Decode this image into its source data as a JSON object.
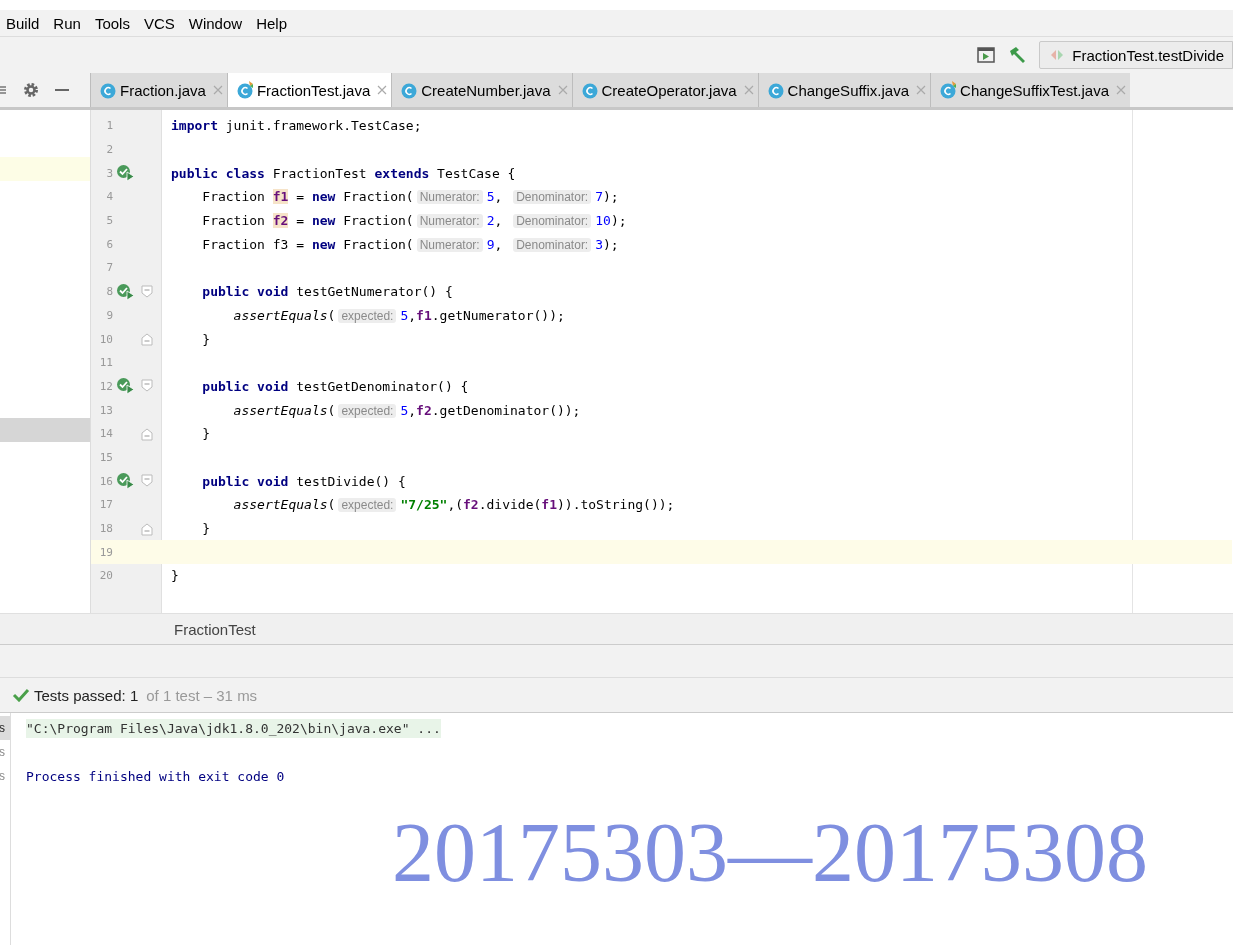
{
  "menu": [
    "Build",
    "Run",
    "Tools",
    "VCS",
    "Window",
    "Help"
  ],
  "run_config": {
    "label": "FractionTest.testDivide"
  },
  "tabs": [
    {
      "label": "Fraction.java",
      "kind": "class",
      "selected": false
    },
    {
      "label": "FractionTest.java",
      "kind": "test",
      "selected": true
    },
    {
      "label": "CreateNumber.java",
      "kind": "class",
      "selected": false
    },
    {
      "label": "CreateOperator.java",
      "kind": "class",
      "selected": false
    },
    {
      "label": "ChangeSuffix.java",
      "kind": "class",
      "selected": false
    },
    {
      "label": "ChangeSuffixTest.java",
      "kind": "test",
      "selected": false
    }
  ],
  "side_rows": [
    {
      "kind": "plain"
    },
    {
      "kind": "plain"
    },
    {
      "kind": "caret"
    },
    {
      "kind": "plain"
    },
    {
      "kind": "plain"
    },
    {
      "kind": "plain"
    },
    {
      "kind": "plain"
    },
    {
      "kind": "plain"
    },
    {
      "kind": "plain"
    },
    {
      "kind": "plain"
    },
    {
      "kind": "plain"
    },
    {
      "kind": "plain"
    },
    {
      "kind": "plain"
    },
    {
      "kind": "selected"
    },
    {
      "kind": "plain"
    },
    {
      "kind": "plain"
    },
    {
      "kind": "plain"
    },
    {
      "kind": "plain"
    },
    {
      "kind": "plain"
    },
    {
      "kind": "plain"
    }
  ],
  "lines": [
    {
      "number": "1",
      "run": false,
      "current": false,
      "tokens": [
        {
          "kind": "kw",
          "text": "import"
        },
        {
          "kind": "text",
          "text": " junit.framework.TestCase;"
        }
      ]
    },
    {
      "number": "2",
      "run": false,
      "current": false
    },
    {
      "number": "3",
      "run": true,
      "current": false,
      "tokens": [
        {
          "kind": "kw",
          "text": "public class"
        },
        {
          "kind": "text",
          "text": " FractionTest "
        },
        {
          "kind": "kw",
          "text": "extends"
        },
        {
          "kind": "text",
          "text": " TestCase {"
        }
      ]
    },
    {
      "number": "4",
      "run": false,
      "current": false,
      "tokens": [
        {
          "kind": "text",
          "text": "    Fraction "
        },
        {
          "kind": "usage",
          "text": "f1"
        },
        {
          "kind": "text",
          "text": " = "
        },
        {
          "kind": "kw",
          "text": "new"
        },
        {
          "kind": "text",
          "text": " Fraction("
        },
        {
          "kind": "hint",
          "text": "Numerator:"
        },
        {
          "kind": "num",
          "text": "5"
        },
        {
          "kind": "text",
          "text": ", "
        },
        {
          "kind": "hint",
          "text": "Denominator:"
        },
        {
          "kind": "num",
          "text": "7"
        },
        {
          "kind": "text",
          "text": ");"
        }
      ]
    },
    {
      "number": "5",
      "run": false,
      "current": false,
      "tokens": [
        {
          "kind": "text",
          "text": "    Fraction "
        },
        {
          "kind": "usage",
          "text": "f2"
        },
        {
          "kind": "text",
          "text": " = "
        },
        {
          "kind": "kw",
          "text": "new"
        },
        {
          "kind": "text",
          "text": " Fraction("
        },
        {
          "kind": "hint",
          "text": "Numerator:"
        },
        {
          "kind": "num",
          "text": "2"
        },
        {
          "kind": "text",
          "text": ", "
        },
        {
          "kind": "hint",
          "text": "Denominator:"
        },
        {
          "kind": "num",
          "text": "10"
        },
        {
          "kind": "text",
          "text": ");"
        }
      ]
    },
    {
      "number": "6",
      "run": false,
      "current": false,
      "tokens": [
        {
          "kind": "text",
          "text": "    Fraction f3 = "
        },
        {
          "kind": "kw",
          "text": "new"
        },
        {
          "kind": "text",
          "text": " Fraction("
        },
        {
          "kind": "hint",
          "text": "Numerator:"
        },
        {
          "kind": "num",
          "text": "9"
        },
        {
          "kind": "text",
          "text": ", "
        },
        {
          "kind": "hint",
          "text": "Denominator:"
        },
        {
          "kind": "num",
          "text": "3"
        },
        {
          "kind": "text",
          "text": ");"
        }
      ]
    },
    {
      "number": "7",
      "run": false,
      "current": false
    },
    {
      "number": "8",
      "run": true,
      "kind": "block_start",
      "current": false,
      "tokens": [
        {
          "kind": "kw",
          "text": "    public void"
        },
        {
          "kind": "text",
          "text": " testGetNumerator() {"
        }
      ]
    },
    {
      "number": "9",
      "run": false,
      "current": false,
      "tokens": [
        {
          "kind": "call",
          "text": "        assertEquals"
        },
        {
          "kind": "text",
          "text": "("
        },
        {
          "kind": "hint",
          "text": "expected:"
        },
        {
          "kind": "num",
          "text": "5"
        },
        {
          "kind": "text",
          "text": ","
        },
        {
          "kind": "field",
          "text": "f1"
        },
        {
          "kind": "text",
          "text": ".getNumerator());"
        }
      ]
    },
    {
      "number": "10",
      "run": false,
      "kind": "block_end",
      "current": false,
      "tokens": [
        {
          "kind": "text",
          "text": "    }"
        }
      ]
    },
    {
      "number": "11",
      "run": false,
      "current": false
    },
    {
      "number": "12",
      "run": true,
      "kind": "block_start",
      "current": false,
      "tokens": [
        {
          "kind": "kw",
          "text": "    public void"
        },
        {
          "kind": "text",
          "text": " testGetDenominator() {"
        }
      ]
    },
    {
      "number": "13",
      "run": false,
      "current": false,
      "tokens": [
        {
          "kind": "call",
          "text": "        assertEquals"
        },
        {
          "kind": "text",
          "text": "("
        },
        {
          "kind": "hint",
          "text": "expected:"
        },
        {
          "kind": "num",
          "text": "5"
        },
        {
          "kind": "text",
          "text": ","
        },
        {
          "kind": "field",
          "text": "f2"
        },
        {
          "kind": "text",
          "text": ".getDenominator());"
        }
      ]
    },
    {
      "number": "14",
      "run": false,
      "kind": "block_end",
      "current": false,
      "tokens": [
        {
          "kind": "text",
          "text": "    }"
        }
      ]
    },
    {
      "number": "15",
      "run": false,
      "current": false
    },
    {
      "number": "16",
      "run": true,
      "kind": "block_start",
      "current": false,
      "tokens": [
        {
          "kind": "kw",
          "text": "    public void"
        },
        {
          "kind": "text",
          "text": " testDivide() {"
        }
      ]
    },
    {
      "number": "17",
      "run": false,
      "current": false,
      "tokens": [
        {
          "kind": "call",
          "text": "        assertEquals"
        },
        {
          "kind": "text",
          "text": "("
        },
        {
          "kind": "hint",
          "text": "expected:"
        },
        {
          "kind": "str",
          "text": "\"7/25\""
        },
        {
          "kind": "text",
          "text": ",("
        },
        {
          "kind": "field",
          "text": "f2"
        },
        {
          "kind": "text",
          "text": ".divide("
        },
        {
          "kind": "field",
          "text": "f1"
        },
        {
          "kind": "text",
          "text": ")).toString());"
        }
      ]
    },
    {
      "number": "18",
      "run": false,
      "kind": "block_end",
      "current": false,
      "tokens": [
        {
          "kind": "text",
          "text": "    }"
        }
      ]
    },
    {
      "number": "19",
      "run": false,
      "current": true
    },
    {
      "number": "20",
      "run": false,
      "current": false,
      "tokens": [
        {
          "kind": "text",
          "text": "}"
        }
      ]
    }
  ],
  "breadcrumb": "FractionTest",
  "test_status": {
    "passed": "Tests passed: 1",
    "detail": "of 1 test – 31 ms"
  },
  "console_side": [
    {
      "text": "s",
      "selected": true
    },
    {
      "text": "s",
      "selected": false
    },
    {
      "text": "s",
      "selected": false
    }
  ],
  "console": [
    {
      "kind": "command",
      "text": "\"C:\\Program Files\\Java\\jdk1.8.0_202\\bin\\java.exe\" ..."
    },
    {
      "kind": "blank"
    },
    {
      "kind": "output",
      "text": "Process finished with exit code 0"
    }
  ],
  "overlay_text": "20175303—20175308"
}
